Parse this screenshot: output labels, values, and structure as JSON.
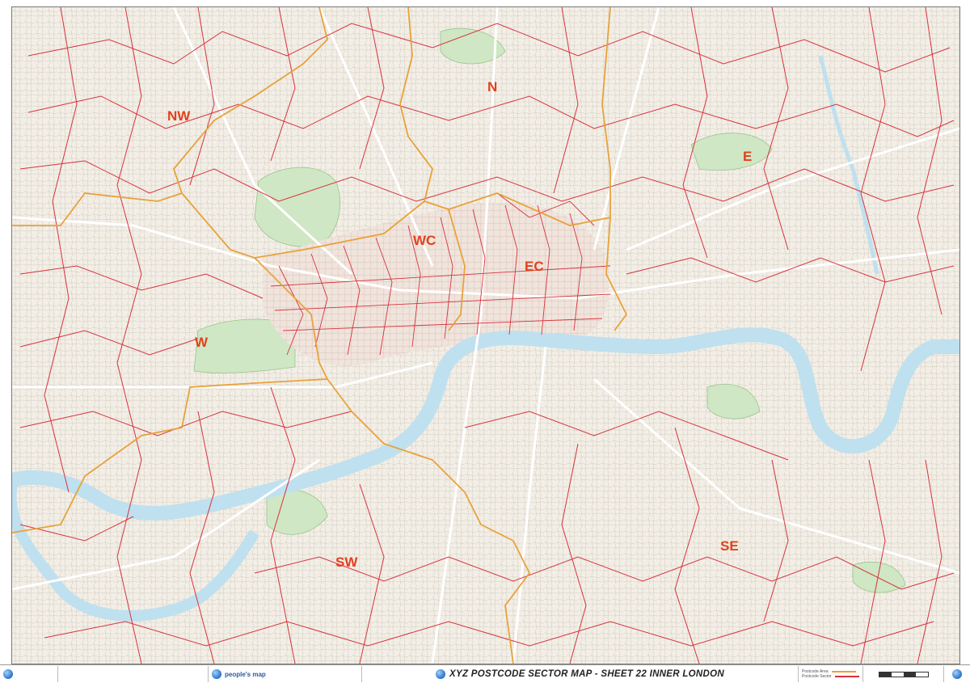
{
  "title": "XYZ POSTCODE SECTOR MAP - SHEET 22 INNER LONDON",
  "brand": "people's map",
  "areas": [
    {
      "code": "NW"
    },
    {
      "code": "N"
    },
    {
      "code": "E"
    },
    {
      "code": "WC"
    },
    {
      "code": "EC"
    },
    {
      "code": "W"
    },
    {
      "code": "SW"
    },
    {
      "code": "SE"
    }
  ],
  "legend": {
    "area_label": "Postcode Area",
    "sector_label": "Postcode Sector",
    "area_color": "#e8a23a",
    "sector_color": "#d8323c"
  },
  "colors": {
    "river": "#bfe0ef",
    "park": "#cfe7c4",
    "sector_line": "#d8323c",
    "area_line": "#e8a23a",
    "label": "#e2411c",
    "road": "#ffffff"
  }
}
